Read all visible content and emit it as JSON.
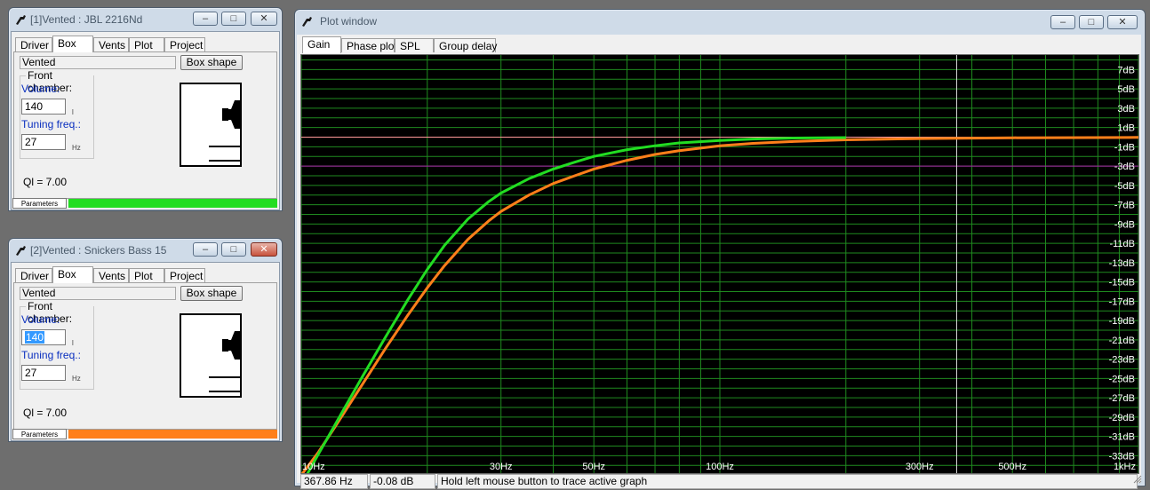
{
  "windows": [
    {
      "id": "box1",
      "title": "[1]Vented : JBL 2216Nd",
      "tabs": [
        "Driver",
        "Box",
        "Vents",
        "Plot",
        "Project"
      ],
      "active_tab": "Box",
      "box_type": "Vented",
      "box_shape_button": "Box shape",
      "front_chamber_label": "Front chamber:",
      "volume_label": "Volume:",
      "volume_value": "140",
      "volume_unit": "l",
      "tuning_label": "Tuning freq.:",
      "tuning_value": "27",
      "tuning_unit": "Hz",
      "ql": "Ql = 7.00",
      "parameters_tab": "Parameters",
      "color": "#22dd22",
      "close_active": false
    },
    {
      "id": "box2",
      "title": "[2]Vented : Snickers Bass 15",
      "tabs": [
        "Driver",
        "Box",
        "Vents",
        "Plot",
        "Project"
      ],
      "active_tab": "Box",
      "box_type": "Vented",
      "box_shape_button": "Box shape",
      "front_chamber_label": "Front chamber:",
      "volume_label": "Volume:",
      "volume_value": "140",
      "volume_unit": "l",
      "tuning_label": "Tuning freq.:",
      "tuning_value": "27",
      "tuning_unit": "Hz",
      "ql": "Ql = 7.00",
      "parameters_tab": "Parameters",
      "color": "#ff7f1a",
      "close_active": true
    }
  ],
  "plot_window": {
    "title": "Plot window",
    "tabs": [
      "Gain",
      "Phase plot",
      "SPL",
      "Group delay"
    ],
    "active_tab": "Gain",
    "status_freq": "367.86 Hz",
    "status_db": "-0.08 dB",
    "status_hint": "Hold left mouse button to trace active graph",
    "window_buttons": [
      "–",
      "□",
      "✕"
    ]
  },
  "chart_data": {
    "type": "line",
    "xscale": "log",
    "xlim": [
      10,
      1000
    ],
    "ylim": [
      -34.8,
      8.5
    ],
    "x_tick_labels": [
      {
        "x": 10,
        "label": "10Hz"
      },
      {
        "x": 30,
        "label": "30Hz"
      },
      {
        "x": 50,
        "label": "50Hz"
      },
      {
        "x": 100,
        "label": "100Hz"
      },
      {
        "x": 300,
        "label": "300Hz"
      },
      {
        "x": 500,
        "label": "500Hz"
      },
      {
        "x": 1000,
        "label": "1kHz"
      }
    ],
    "y_tick_labels": [
      {
        "y": 7,
        "label": "7dB"
      },
      {
        "y": 5,
        "label": "5dB"
      },
      {
        "y": 3,
        "label": "3dB"
      },
      {
        "y": 1,
        "label": "1dB"
      },
      {
        "y": -1,
        "label": "-1dB"
      },
      {
        "y": -3,
        "label": "-3dB"
      },
      {
        "y": -5,
        "label": "-5dB"
      },
      {
        "y": -7,
        "label": "-7dB"
      },
      {
        "y": -9,
        "label": "-9dB"
      },
      {
        "y": -11,
        "label": "-11dB"
      },
      {
        "y": -13,
        "label": "-13dB"
      },
      {
        "y": -15,
        "label": "-15dB"
      },
      {
        "y": -17,
        "label": "-17dB"
      },
      {
        "y": -19,
        "label": "-19dB"
      },
      {
        "y": -21,
        "label": "-21dB"
      },
      {
        "y": -23,
        "label": "-23dB"
      },
      {
        "y": -25,
        "label": "-25dB"
      },
      {
        "y": -27,
        "label": "-27dB"
      },
      {
        "y": -29,
        "label": "-29dB"
      },
      {
        "y": -31,
        "label": "-31dB"
      },
      {
        "y": -33,
        "label": "-33dB"
      }
    ],
    "grid": true,
    "reference_lines": [
      {
        "y": 0,
        "color": "#ff9999"
      },
      {
        "y": -3,
        "color": "#aa22aa"
      }
    ],
    "cursor_x": 367.86,
    "series": [
      {
        "color": "#22dd22",
        "x": [
          10,
          11,
          12,
          14,
          16,
          18,
          20,
          22,
          25,
          28,
          30,
          35,
          40,
          45,
          50,
          60,
          70,
          80,
          100,
          120,
          150,
          200
        ],
        "y": [
          -36,
          -32.8,
          -29.9,
          -24.8,
          -20.5,
          -16.8,
          -13.7,
          -11.2,
          -8.5,
          -6.7,
          -5.8,
          -4.3,
          -3.3,
          -2.6,
          -2.0,
          -1.3,
          -0.9,
          -0.6,
          -0.35,
          -0.2,
          -0.1,
          -0.05
        ]
      },
      {
        "color": "#ff7f1a",
        "x": [
          10,
          11,
          12,
          14,
          16,
          18,
          20,
          22,
          25,
          28,
          30,
          35,
          40,
          45,
          50,
          60,
          70,
          80,
          100,
          120,
          150,
          200,
          300,
          500,
          1000
        ],
        "y": [
          -35,
          -32.6,
          -30.1,
          -25.6,
          -21.7,
          -18.4,
          -15.6,
          -13.3,
          -10.6,
          -8.7,
          -7.7,
          -6.0,
          -4.8,
          -4.0,
          -3.3,
          -2.4,
          -1.8,
          -1.4,
          -0.9,
          -0.65,
          -0.45,
          -0.28,
          -0.15,
          -0.07,
          -0.03
        ]
      }
    ]
  }
}
